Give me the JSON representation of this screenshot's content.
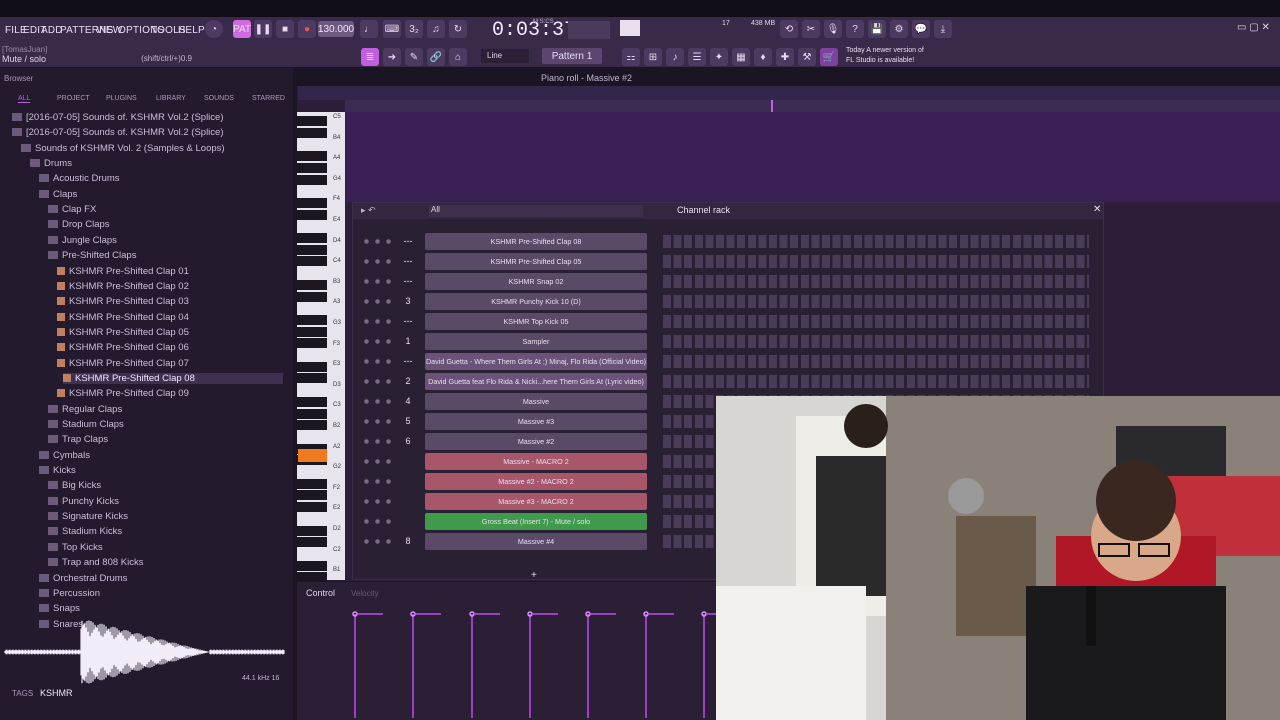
{
  "menu": [
    "FILE",
    "EDIT",
    "ADD",
    "PATTERNS",
    "VIEW",
    "OPTIONS",
    "TOOLS",
    "HELP"
  ],
  "transport": {
    "tempo": "130.000",
    "time": "0:03:37",
    "time_unit": "M:S:CS",
    "cpu": "17",
    "mem": "438 MB",
    "pattern": "Pattern 1",
    "snap": "Line"
  },
  "hint": {
    "user": "[TomasJuan]",
    "text": "Mute / solo",
    "shortcut": "(shift/ctrl/+)0.9"
  },
  "news": {
    "line1": "Today  A newer version of",
    "line2": "FL Studio is available!"
  },
  "browser": {
    "title": "Browser",
    "tabs": [
      "ALL",
      "PROJECT",
      "PLUGINS",
      "LIBRARY",
      "SOUNDS",
      "STARRED"
    ],
    "tree": [
      {
        "label": "[2016-07-05] Sounds of. KSHMR Vol.2 (Splice)",
        "indent": 0,
        "type": "folder"
      },
      {
        "label": "[2016-07-05] Sounds of. KSHMR Vol.2 (Splice)",
        "indent": 0,
        "type": "folder"
      },
      {
        "label": "Sounds of KSHMR Vol. 2 (Samples & Loops)",
        "indent": 1,
        "type": "folder"
      },
      {
        "label": "Drums",
        "indent": 2,
        "type": "folder"
      },
      {
        "label": "Acoustic Drums",
        "indent": 3,
        "type": "folder"
      },
      {
        "label": "Claps",
        "indent": 3,
        "type": "folder"
      },
      {
        "label": "Clap FX",
        "indent": 4,
        "type": "folder"
      },
      {
        "label": "Drop Claps",
        "indent": 4,
        "type": "folder"
      },
      {
        "label": "Jungle Claps",
        "indent": 4,
        "type": "folder"
      },
      {
        "label": "Pre-Shifted Claps",
        "indent": 4,
        "type": "folder"
      },
      {
        "label": "KSHMR Pre-Shifted Clap 01",
        "indent": 5,
        "type": "file"
      },
      {
        "label": "KSHMR Pre-Shifted Clap 02",
        "indent": 5,
        "type": "file"
      },
      {
        "label": "KSHMR Pre-Shifted Clap 03",
        "indent": 5,
        "type": "file"
      },
      {
        "label": "KSHMR Pre-Shifted Clap 04",
        "indent": 5,
        "type": "file"
      },
      {
        "label": "KSHMR Pre-Shifted Clap 05",
        "indent": 5,
        "type": "file"
      },
      {
        "label": "KSHMR Pre-Shifted Clap 06",
        "indent": 5,
        "type": "file"
      },
      {
        "label": "KSHMR Pre-Shifted Clap 07",
        "indent": 5,
        "type": "file"
      },
      {
        "label": "KSHMR Pre-Shifted Clap 08",
        "indent": 5,
        "type": "file",
        "selected": true
      },
      {
        "label": "KSHMR Pre-Shifted Clap 09",
        "indent": 5,
        "type": "file"
      },
      {
        "label": "Regular Claps",
        "indent": 4,
        "type": "folder"
      },
      {
        "label": "Stadium Claps",
        "indent": 4,
        "type": "folder"
      },
      {
        "label": "Trap Claps",
        "indent": 4,
        "type": "folder"
      },
      {
        "label": "Cymbals",
        "indent": 3,
        "type": "folder"
      },
      {
        "label": "Kicks",
        "indent": 3,
        "type": "folder"
      },
      {
        "label": "Big Kicks",
        "indent": 4,
        "type": "folder"
      },
      {
        "label": "Punchy Kicks",
        "indent": 4,
        "type": "folder"
      },
      {
        "label": "Signature Kicks",
        "indent": 4,
        "type": "folder"
      },
      {
        "label": "Stadium Kicks",
        "indent": 4,
        "type": "folder"
      },
      {
        "label": "Top Kicks",
        "indent": 4,
        "type": "folder"
      },
      {
        "label": "Trap and 808 Kicks",
        "indent": 4,
        "type": "folder"
      },
      {
        "label": "Orchestral Drums",
        "indent": 3,
        "type": "folder"
      },
      {
        "label": "Percussion",
        "indent": 3,
        "type": "folder"
      },
      {
        "label": "Snaps",
        "indent": 3,
        "type": "folder"
      },
      {
        "label": "Snares",
        "indent": 3,
        "type": "folder"
      }
    ],
    "sample_rate": "44.1 kHz 16",
    "tags_label": "TAGS",
    "tags_value": "KSHMR"
  },
  "piano_roll": {
    "title": "Piano roll - Massive #2",
    "keys": [
      "C5",
      "B4",
      "A4",
      "G4",
      "F4",
      "E4",
      "D4",
      "C4",
      "B3",
      "A3",
      "G3",
      "F3",
      "E3",
      "D3",
      "C3",
      "B2",
      "A2",
      "G2",
      "F2",
      "E2",
      "D2",
      "C2",
      "B1"
    ],
    "bar_labels": [
      "2",
      "3",
      "4"
    ]
  },
  "channel_rack": {
    "title": "Channel rack",
    "filter": "All",
    "channels": [
      {
        "num": "---",
        "name": "KSHMR Pre-Shifted Clap 08",
        "color": "#5a4a68"
      },
      {
        "num": "---",
        "name": "KSHMR Pre-Shifted Clap 05",
        "color": "#5a4a68"
      },
      {
        "num": "---",
        "name": "KSHMR Snap 02",
        "color": "#5a4a68"
      },
      {
        "num": "3",
        "name": "KSHMR Punchy Kick 10 (D)",
        "color": "#5a4a68"
      },
      {
        "num": "---",
        "name": "KSHMR Top Kick 05",
        "color": "#5a4a68"
      },
      {
        "num": "1",
        "name": "Sampler",
        "color": "#5a4a68"
      },
      {
        "num": "---",
        "name": "David Guetta - Where Them Girls At ;) Minaj, Flo Rida (Official Video)",
        "color": "#6a5278"
      },
      {
        "num": "2",
        "name": "David Guetta feat Flo Rida & Nicki...here Them Girls At (Lyric video)",
        "color": "#6a5278"
      },
      {
        "num": "4",
        "name": "Massive",
        "color": "#5a4a68"
      },
      {
        "num": "5",
        "name": "Massive #3",
        "color": "#5a4a68"
      },
      {
        "num": "6",
        "name": "Massive #2",
        "color": "#5a4a68"
      },
      {
        "num": "",
        "name": "Massive - MACRO 2",
        "color": "#a8566a"
      },
      {
        "num": "",
        "name": "Massive #2 - MACRO 2",
        "color": "#a8566a"
      },
      {
        "num": "",
        "name": "Massive #3 - MACRO 2",
        "color": "#a8566a"
      },
      {
        "num": "",
        "name": "Gross Beat (Insert 7) - Mute / solo",
        "color": "#3f9a4c"
      },
      {
        "num": "8",
        "name": "Massive #4",
        "color": "#5a4a68"
      }
    ]
  },
  "control": {
    "label": "Control",
    "velocity": "Velocity"
  },
  "colors": {
    "accent": "#c040e0",
    "bg": "#1b1422"
  }
}
